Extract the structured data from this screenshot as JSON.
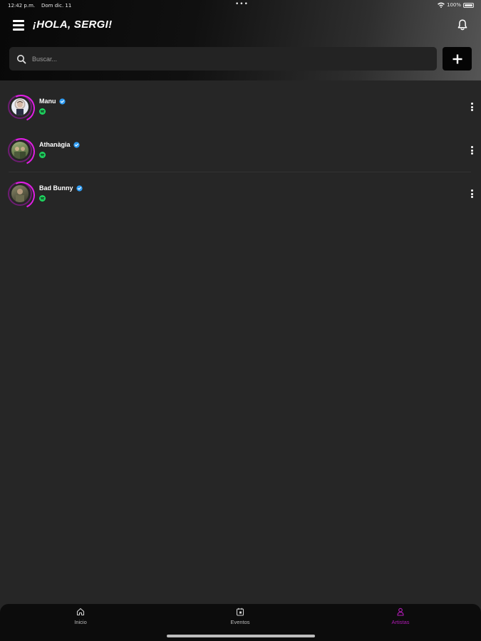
{
  "status_bar": {
    "time": "12:42 p.m.",
    "date": "Dom dic. 11",
    "battery": "100%"
  },
  "header": {
    "greeting": "¡HOLA, SERGI!"
  },
  "search": {
    "placeholder": "Buscar..."
  },
  "artists": [
    {
      "name": "Manu",
      "verified": true,
      "platform_icon": "spotify-icon"
    },
    {
      "name": "Athanàgia",
      "verified": true,
      "platform_icon": "spotify-icon"
    },
    {
      "name": "Bad Bunny",
      "verified": true,
      "platform_icon": "spotify-icon"
    }
  ],
  "tabbar": {
    "tabs": [
      {
        "label": "Inicio",
        "icon": "home-icon",
        "active": false
      },
      {
        "label": "Eventos",
        "icon": "calendar-icon",
        "active": false
      },
      {
        "label": "Artistas",
        "icon": "artist-icon",
        "active": true
      }
    ]
  },
  "colors": {
    "accent": "#b21bb6",
    "ring": "#e21ee6",
    "background": "#262626",
    "verified": "#2f9df4",
    "spotify": "#1ed760"
  }
}
